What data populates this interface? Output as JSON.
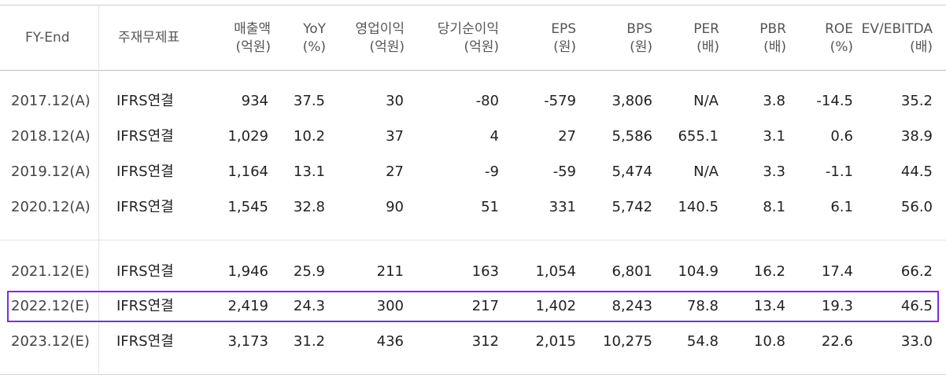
{
  "headers": [
    {
      "line1": "FY-End",
      "line2": ""
    },
    {
      "line1": "주재무제표",
      "line2": ""
    },
    {
      "line1": "매출액",
      "line2": "(억원)"
    },
    {
      "line1": "YoY",
      "line2": "(%)"
    },
    {
      "line1": "영업이익",
      "line2": "(억원)"
    },
    {
      "line1": "당기순이익",
      "line2": "(억원)"
    },
    {
      "line1": "EPS",
      "line2": "(원)"
    },
    {
      "line1": "BPS",
      "line2": "(원)"
    },
    {
      "line1": "PER",
      "line2": "(배)"
    },
    {
      "line1": "PBR",
      "line2": "(배)"
    },
    {
      "line1": "ROE",
      "line2": "(%)"
    },
    {
      "line1": "EV/EBITDA",
      "line2": "(배)"
    }
  ],
  "rows": [
    [
      "2017.12(A)",
      "IFRS연결",
      "934",
      "37.5",
      "30",
      "-80",
      "-579",
      "3,806",
      "N/A",
      "3.8",
      "-14.5",
      "35.2"
    ],
    [
      "2018.12(A)",
      "IFRS연결",
      "1,029",
      "10.2",
      "37",
      "4",
      "27",
      "5,586",
      "655.1",
      "3.1",
      "0.6",
      "38.9"
    ],
    [
      "2019.12(A)",
      "IFRS연결",
      "1,164",
      "13.1",
      "27",
      "-9",
      "-59",
      "5,474",
      "N/A",
      "3.3",
      "-1.1",
      "44.5"
    ],
    [
      "2020.12(A)",
      "IFRS연결",
      "1,545",
      "32.8",
      "90",
      "51",
      "331",
      "5,742",
      "140.5",
      "8.1",
      "6.1",
      "56.0"
    ],
    [
      "2021.12(E)",
      "IFRS연결",
      "1,946",
      "25.9",
      "211",
      "163",
      "1,054",
      "6,801",
      "104.9",
      "16.2",
      "17.4",
      "66.2"
    ],
    [
      "2022.12(E)",
      "IFRS연결",
      "2,419",
      "24.3",
      "300",
      "217",
      "1,402",
      "8,243",
      "78.8",
      "13.4",
      "19.3",
      "46.5"
    ],
    [
      "2023.12(E)",
      "IFRS연결",
      "3,173",
      "31.2",
      "436",
      "312",
      "2,015",
      "10,275",
      "54.8",
      "10.8",
      "22.6",
      "33.0"
    ]
  ],
  "highlighted_row": "2022.12(E)",
  "colors": {
    "highlight": "#7b2ee0",
    "rule_dark": "#bbbbbb",
    "rule_light": "#e3e3e3"
  }
}
